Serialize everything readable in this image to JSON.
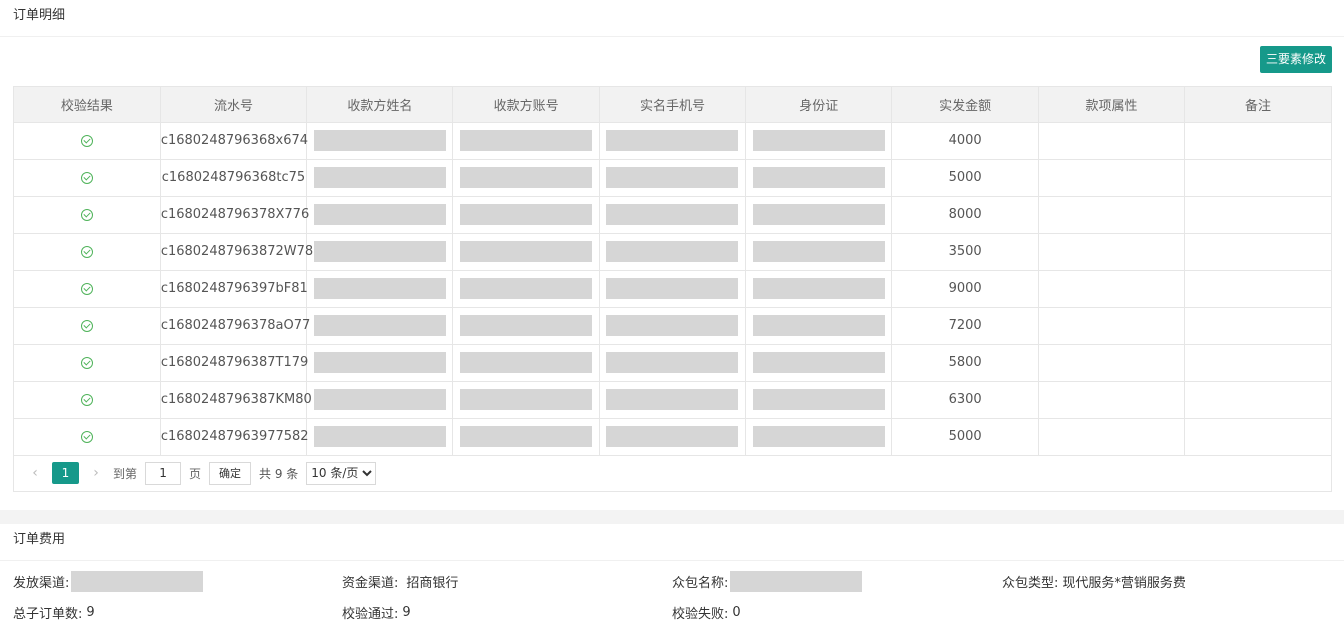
{
  "order_detail": {
    "title": "订单明细",
    "edit_button": "三要素修改",
    "columns": [
      "校验结果",
      "流水号",
      "收款方姓名",
      "收款方账号",
      "实名手机号",
      "身份证",
      "实发金额",
      "款项属性",
      "备注"
    ],
    "rows": [
      {
        "serial": "c1680248796368x674",
        "amount": "4000"
      },
      {
        "serial": "c1680248796368tc75",
        "amount": "5000"
      },
      {
        "serial": "c1680248796378X776",
        "amount": "8000"
      },
      {
        "serial": "c16802487963872W78",
        "amount": "3500"
      },
      {
        "serial": "c1680248796397bF81",
        "amount": "9000"
      },
      {
        "serial": "c1680248796378aO77",
        "amount": "7200"
      },
      {
        "serial": "c1680248796387T179",
        "amount": "5800"
      },
      {
        "serial": "c1680248796387KM80",
        "amount": "6300"
      },
      {
        "serial": "c16802487963977582",
        "amount": "5000"
      }
    ],
    "pagination": {
      "prev": "‹",
      "current_page": "1",
      "next": "›",
      "goto_label": "到第",
      "goto_value": "1",
      "page_unit": "页",
      "confirm": "确定",
      "total": "共 9 条",
      "page_size": "10 条/页"
    }
  },
  "order_fee": {
    "title": "订单费用",
    "fields": {
      "channel_label": "发放渠道:",
      "fund_label": "资金渠道:",
      "fund_value": "招商银行",
      "package_name_label": "众包名称:",
      "package_type_label": "众包类型:",
      "package_type_value": "现代服务*营销服务费",
      "total_label": "总子订单数:",
      "total_value": "9",
      "pass_label": "校验通过:",
      "pass_value": "9",
      "fail_label": "校验失败:",
      "fail_value": "0"
    }
  },
  "colors": {
    "accent": "#16998a",
    "check": "#4fb35a",
    "mask": "#d6d6d6"
  }
}
